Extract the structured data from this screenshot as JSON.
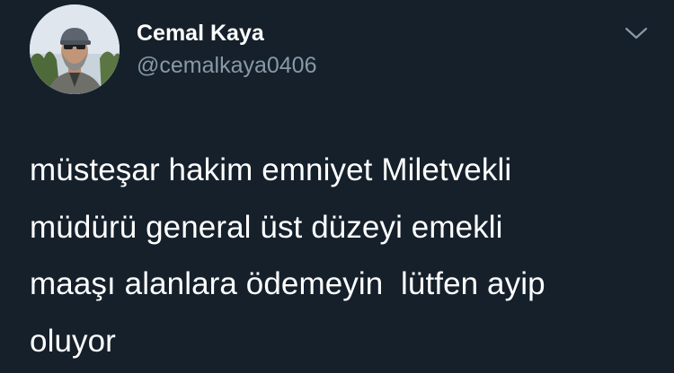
{
  "tweet": {
    "author": {
      "display_name": "Cemal Kaya",
      "handle": "@cemalkaya0406",
      "avatar_icon": "profile-photo"
    },
    "menu_icon": "chevron-down-icon",
    "text": "müsteşar hakim emniyet Miletvekli\nmüdürü general üst düzeyi emekli\nmaaşı alanlara ödemeyin  lütfen ayip\noluyor"
  },
  "colors": {
    "background": "#15202b",
    "text_primary": "#ffffff",
    "text_secondary": "#8899a6"
  }
}
